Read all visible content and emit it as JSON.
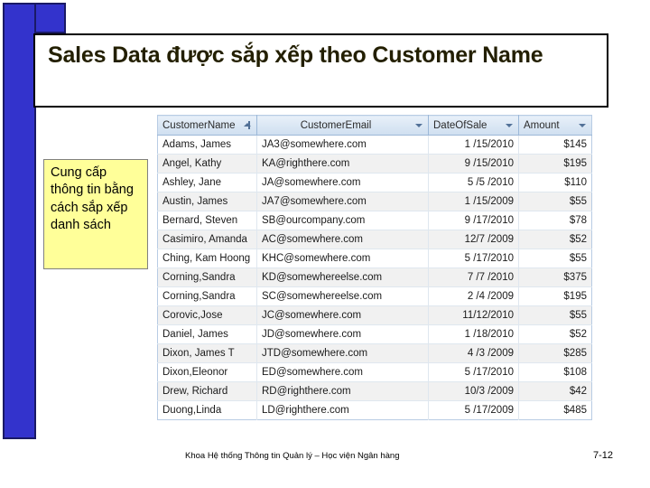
{
  "slide": {
    "title": "Sales Data được sắp xếp theo Customer Name",
    "callout": "Cung cấp thông tin bằng cách sắp xếp danh sách",
    "footer_credit": "Khoa Hệ thống Thông tin Quản lý – Học viện Ngân hàng",
    "page_number": "7-12",
    "accent_color": "#3333cc",
    "callout_color": "#ffff99",
    "header_color": "#dbe7f4"
  },
  "datasheet": {
    "columns": [
      {
        "label": "CustomerName",
        "icon": "sort-ascending-icon",
        "align": "left"
      },
      {
        "label": "CustomerEmail",
        "icon": "dropdown-icon",
        "align": "center"
      },
      {
        "label": "DateOfSale",
        "icon": "dropdown-icon",
        "align": "left"
      },
      {
        "label": "Amount",
        "icon": "dropdown-icon",
        "align": "left"
      }
    ],
    "rows": [
      {
        "name": "Adams, James",
        "email": "JA3@somewhere.com",
        "date": "1 /15/2010",
        "amount": "$145"
      },
      {
        "name": "Angel, Kathy",
        "email": "KA@righthere.com",
        "date": "9 /15/2010",
        "amount": "$195"
      },
      {
        "name": "Ashley, Jane",
        "email": "JA@somewhere.com",
        "date": "5 /5 /2010",
        "amount": "$110"
      },
      {
        "name": "Austin, James",
        "email": "JA7@somewhere.com",
        "date": "1 /15/2009",
        "amount": "$55"
      },
      {
        "name": "Bernard, Steven",
        "email": "SB@ourcompany.com",
        "date": "9 /17/2010",
        "amount": "$78"
      },
      {
        "name": "Casimiro, Amanda",
        "email": "AC@somewhere.com",
        "date": "12/7 /2009",
        "amount": "$52"
      },
      {
        "name": "Ching, Kam Hoong",
        "email": "KHC@somewhere.com",
        "date": "5 /17/2010",
        "amount": "$55"
      },
      {
        "name": "Corning,Sandra",
        "email": "KD@somewhereelse.com",
        "date": "7 /7 /2010",
        "amount": "$375"
      },
      {
        "name": "Corning,Sandra",
        "email": "SC@somewhereelse.com",
        "date": "2 /4 /2009",
        "amount": "$195"
      },
      {
        "name": "Corovic,Jose",
        "email": "JC@somewhere.com",
        "date": "11/12/2010",
        "amount": "$55"
      },
      {
        "name": "Daniel, James",
        "email": "JD@somewhere.com",
        "date": "1 /18/2010",
        "amount": "$52"
      },
      {
        "name": "Dixon, James T",
        "email": "JTD@somewhere.com",
        "date": "4 /3 /2009",
        "amount": "$285"
      },
      {
        "name": "Dixon,Eleonor",
        "email": "ED@somewhere.com",
        "date": "5 /17/2010",
        "amount": "$108"
      },
      {
        "name": "Drew, Richard",
        "email": "RD@righthere.com",
        "date": "10/3 /2009",
        "amount": "$42"
      },
      {
        "name": "Duong,Linda",
        "email": "LD@righthere.com",
        "date": "5 /17/2009",
        "amount": "$485"
      }
    ]
  }
}
